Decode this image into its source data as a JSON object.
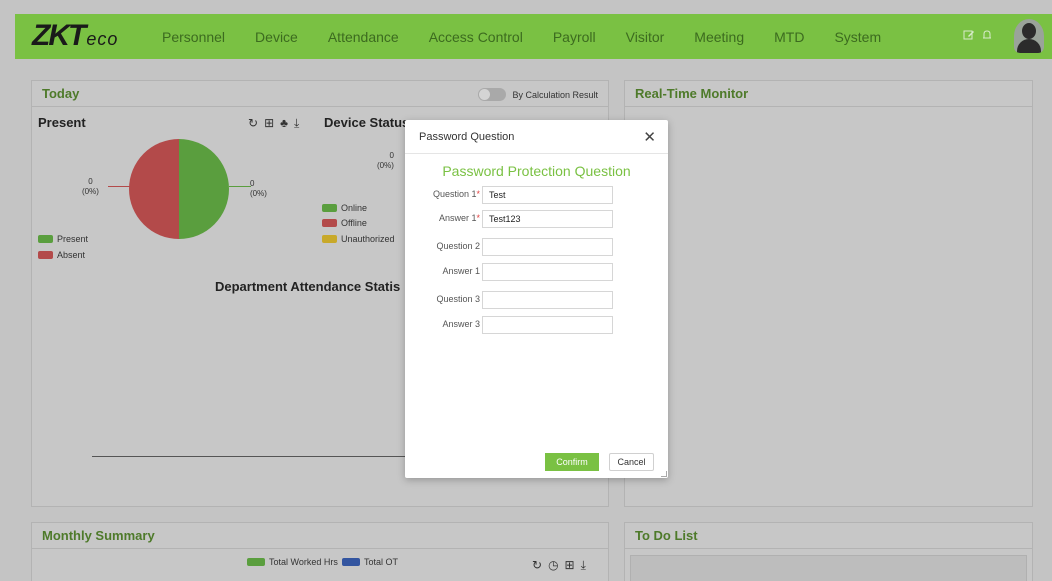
{
  "brand": {
    "logo_main": "ZKT",
    "logo_sub": "eco"
  },
  "nav": [
    "Personnel",
    "Device",
    "Attendance",
    "Access Control",
    "Payroll",
    "Visitor",
    "Meeting",
    "MTD",
    "System"
  ],
  "colors": {
    "brand_green": "#7ac143",
    "present": "#5a9e3e",
    "absent": "#b34a4a",
    "online": "#5a9e3e",
    "offline": "#b34a4a",
    "unauthorized": "#c8a92a",
    "overlay": "#c4c4c4"
  },
  "today": {
    "title": "Today",
    "toggle_label": "By Calculation Result",
    "present": {
      "title": "Present",
      "left_label": "0\n(0%)",
      "right_label": "0\n(0%)",
      "legend": [
        "Present",
        "Absent"
      ]
    },
    "device_status": {
      "title": "Device Status",
      "label": "0\n(0%)",
      "legend": [
        "Online",
        "Offline",
        "Unauthorized"
      ]
    },
    "department_title": "Department Attendance Statis"
  },
  "realtime": {
    "title": "Real-Time Monitor"
  },
  "monthly": {
    "title": "Monthly Summary",
    "legend": [
      "Total Worked Hrs",
      "Total OT"
    ],
    "colors": [
      "#5a9e3e",
      "#3355a0"
    ]
  },
  "todo": {
    "title": "To Do List"
  },
  "modal": {
    "title": "Password Question",
    "subtitle": "Password Protection Question",
    "fields": [
      {
        "label": "Question 1",
        "required": "*",
        "value": "Test"
      },
      {
        "label": "Answer 1",
        "required": "*",
        "value": "Test123"
      },
      {
        "label": "Question 2",
        "required": "",
        "value": ""
      },
      {
        "label": "Answer 1",
        "required": "",
        "value": ""
      },
      {
        "label": "Question 3",
        "required": "",
        "value": ""
      },
      {
        "label": "Answer 3",
        "required": "",
        "value": ""
      }
    ],
    "confirm": "Confirm",
    "cancel": "Cancel"
  },
  "chart_data": {
    "type": "pie",
    "title": "Present",
    "categories": [
      "Present",
      "Absent"
    ],
    "values": [
      0,
      0
    ],
    "labels": [
      "0 (0%)",
      "0 (0%)"
    ]
  }
}
